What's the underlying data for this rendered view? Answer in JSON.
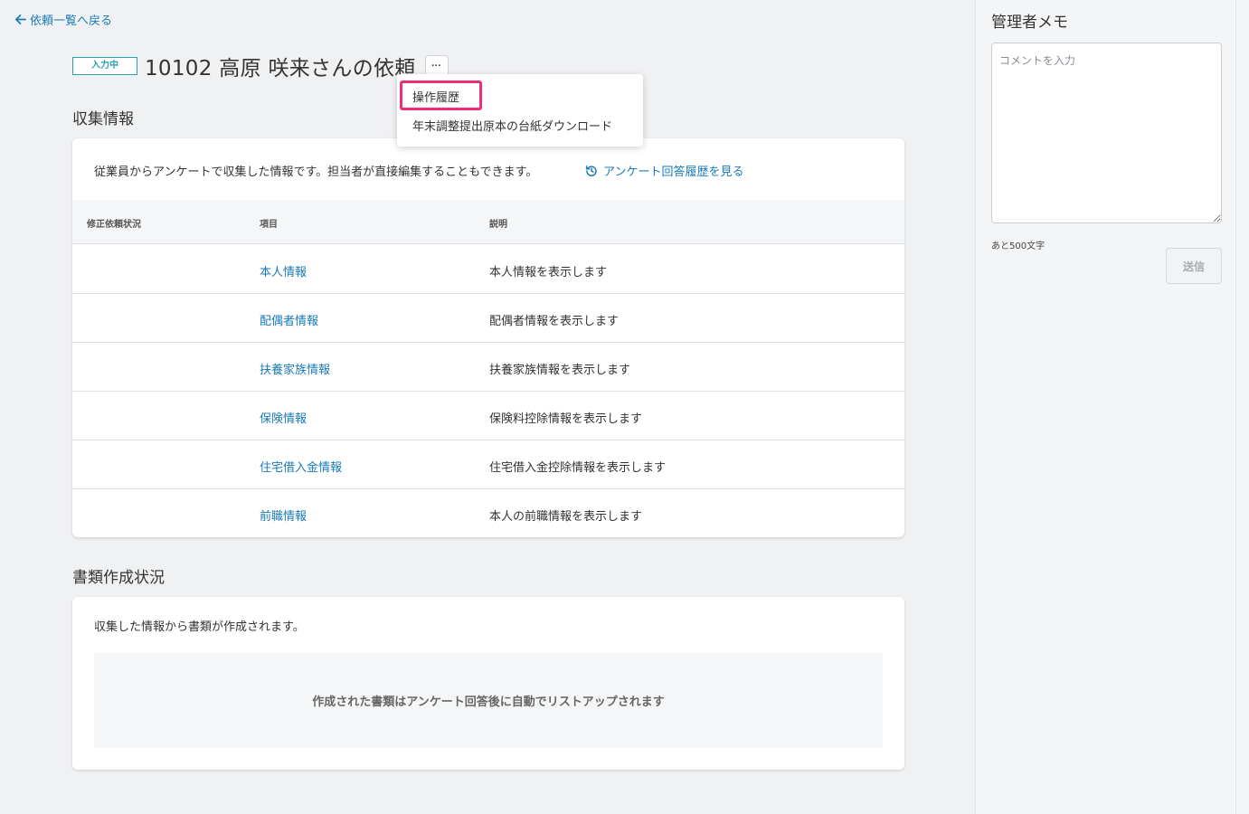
{
  "nav": {
    "back_label": "依頼一覧へ戻る"
  },
  "header": {
    "status": "入力中",
    "title": "10102 高原 咲来さんの依頼",
    "more_label": "···"
  },
  "dropdown": {
    "items": [
      {
        "label": "操作履歴",
        "highlighted": true
      },
      {
        "label": "年末調整提出原本の台紙ダウンロード"
      }
    ],
    "highlight_color": "#ec2f7a"
  },
  "collected": {
    "heading": "収集情報",
    "description": "従業員からアンケートで収集した情報です。担当者が直接編集することもできます。",
    "history_link": "アンケート回答履歴を見る",
    "columns": [
      "修正依頼状況",
      "項目",
      "説明"
    ],
    "rows": [
      {
        "status": "",
        "item": "本人情報",
        "desc": "本人情報を表示します"
      },
      {
        "status": "",
        "item": "配偶者情報",
        "desc": "配偶者情報を表示します"
      },
      {
        "status": "",
        "item": "扶養家族情報",
        "desc": "扶養家族情報を表示します"
      },
      {
        "status": "",
        "item": "保険情報",
        "desc": "保険料控除情報を表示します"
      },
      {
        "status": "",
        "item": "住宅借入金情報",
        "desc": "住宅借入金控除情報を表示します"
      },
      {
        "status": "",
        "item": "前職情報",
        "desc": "本人の前職情報を表示します"
      }
    ]
  },
  "documents": {
    "heading": "書類作成状況",
    "description": "収集した情報から書類が作成されます。",
    "empty_message": "作成された書類はアンケート回答後に自動でリストアップされます"
  },
  "memo": {
    "title": "管理者メモ",
    "placeholder": "コメントを入力",
    "value": "",
    "counter": "あと500文字",
    "send_label": "送信"
  },
  "colors": {
    "link": "#1a7bb8",
    "status_badge": "#2aa0b4",
    "background": "#f0f1f3"
  }
}
